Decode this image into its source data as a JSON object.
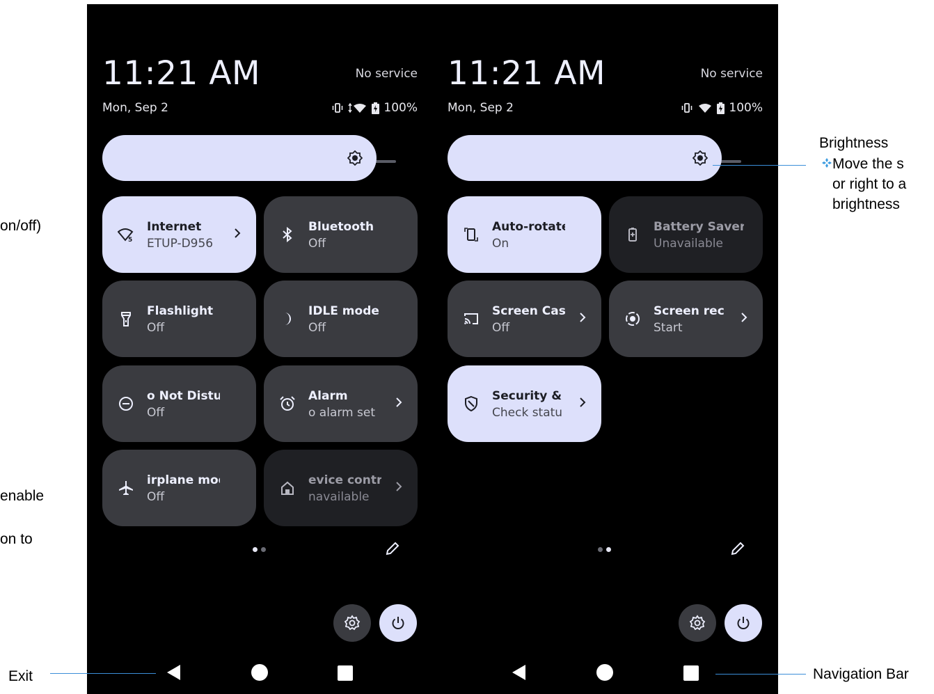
{
  "left_screen": {
    "time": "11:21 AM",
    "date": "Mon, Sep 2",
    "service": "No service",
    "battery": "100%",
    "tiles": [
      {
        "title": "Internet",
        "subtitle": "ETUP-D956",
        "icon": "wifi-icon",
        "state": "active",
        "chevron": true
      },
      {
        "title": "Bluetooth",
        "subtitle": "Off",
        "icon": "bluetooth-icon",
        "state": "inactive",
        "chevron": false
      },
      {
        "title": "Flashlight",
        "subtitle": "Off",
        "icon": "flashlight-icon",
        "state": "inactive",
        "chevron": false
      },
      {
        "title": "IDLE mode",
        "subtitle": "Off",
        "icon": "moon-icon",
        "state": "inactive",
        "chevron": false
      },
      {
        "title": "o Not Disturb",
        "subtitle": "Off",
        "icon": "do-not-disturb-icon",
        "state": "inactive",
        "chevron": false
      },
      {
        "title": "Alarm",
        "subtitle": "o alarm set",
        "icon": "alarm-icon",
        "state": "inactive",
        "chevron": true
      },
      {
        "title": "irplane mode",
        "subtitle": "Off",
        "icon": "airplane-icon",
        "state": "inactive",
        "chevron": false
      },
      {
        "title": "evice contr",
        "subtitle": "navailable",
        "icon": "home-icon",
        "state": "unavailable",
        "chevron": true
      }
    ]
  },
  "right_screen": {
    "time": "11:21 AM",
    "date": "Mon, Sep 2",
    "service": "No service",
    "battery": "100%",
    "tiles": [
      {
        "title": "Auto-rotate",
        "subtitle": "On",
        "icon": "rotate-icon",
        "state": "active",
        "chevron": false
      },
      {
        "title": "Battery Saver",
        "subtitle": "Unavailable",
        "icon": "battery-saver-icon",
        "state": "unavailable",
        "chevron": false
      },
      {
        "title": "Screen Cas",
        "subtitle": "Off",
        "icon": "cast-icon",
        "state": "inactive",
        "chevron": true
      },
      {
        "title": "Screen rec",
        "subtitle": "Start",
        "icon": "record-icon",
        "state": "inactive",
        "chevron": true
      },
      {
        "title": "Security & ",
        "subtitle": "Check statu",
        "icon": "shield-icon",
        "state": "active",
        "chevron": true
      }
    ]
  },
  "annotations": {
    "left_fragments": [
      "on/off)",
      "enable",
      "on to"
    ],
    "exit": "Exit",
    "navigation_bar": "Navigation Bar",
    "brightness_title": "Brightness",
    "brightness_lines": [
      "Move the s",
      "or right to a",
      "brightness"
    ]
  },
  "colors": {
    "panel_bg": "#000000",
    "tile_active": "#dde0fb",
    "tile_inactive": "#3a3b40",
    "tile_unavailable": "#1f2024",
    "callout_line": "#3b8ed8"
  }
}
